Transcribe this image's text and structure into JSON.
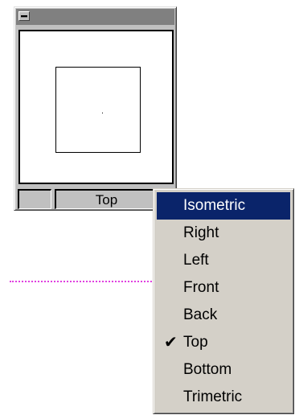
{
  "window": {
    "title": "",
    "system_menu_icon": "system-menu-icon"
  },
  "statusbar": {
    "left_cell": "",
    "view_label": "Top"
  },
  "menu": {
    "items": [
      {
        "label": "Isometric",
        "highlighted": true,
        "checked": false
      },
      {
        "label": "Right",
        "highlighted": false,
        "checked": false
      },
      {
        "label": "Left",
        "highlighted": false,
        "checked": false
      },
      {
        "label": "Front",
        "highlighted": false,
        "checked": false
      },
      {
        "label": "Back",
        "highlighted": false,
        "checked": false
      },
      {
        "label": "Top",
        "highlighted": false,
        "checked": true
      },
      {
        "label": "Bottom",
        "highlighted": false,
        "checked": false
      },
      {
        "label": "Trimetric",
        "highlighted": false,
        "checked": false
      }
    ],
    "check_icon": "check-icon"
  },
  "colors": {
    "highlight": "#0a246a",
    "highlight_text": "#ffffff",
    "menu_bg": "#d4d0c8",
    "guide_line": "#e040e0"
  }
}
